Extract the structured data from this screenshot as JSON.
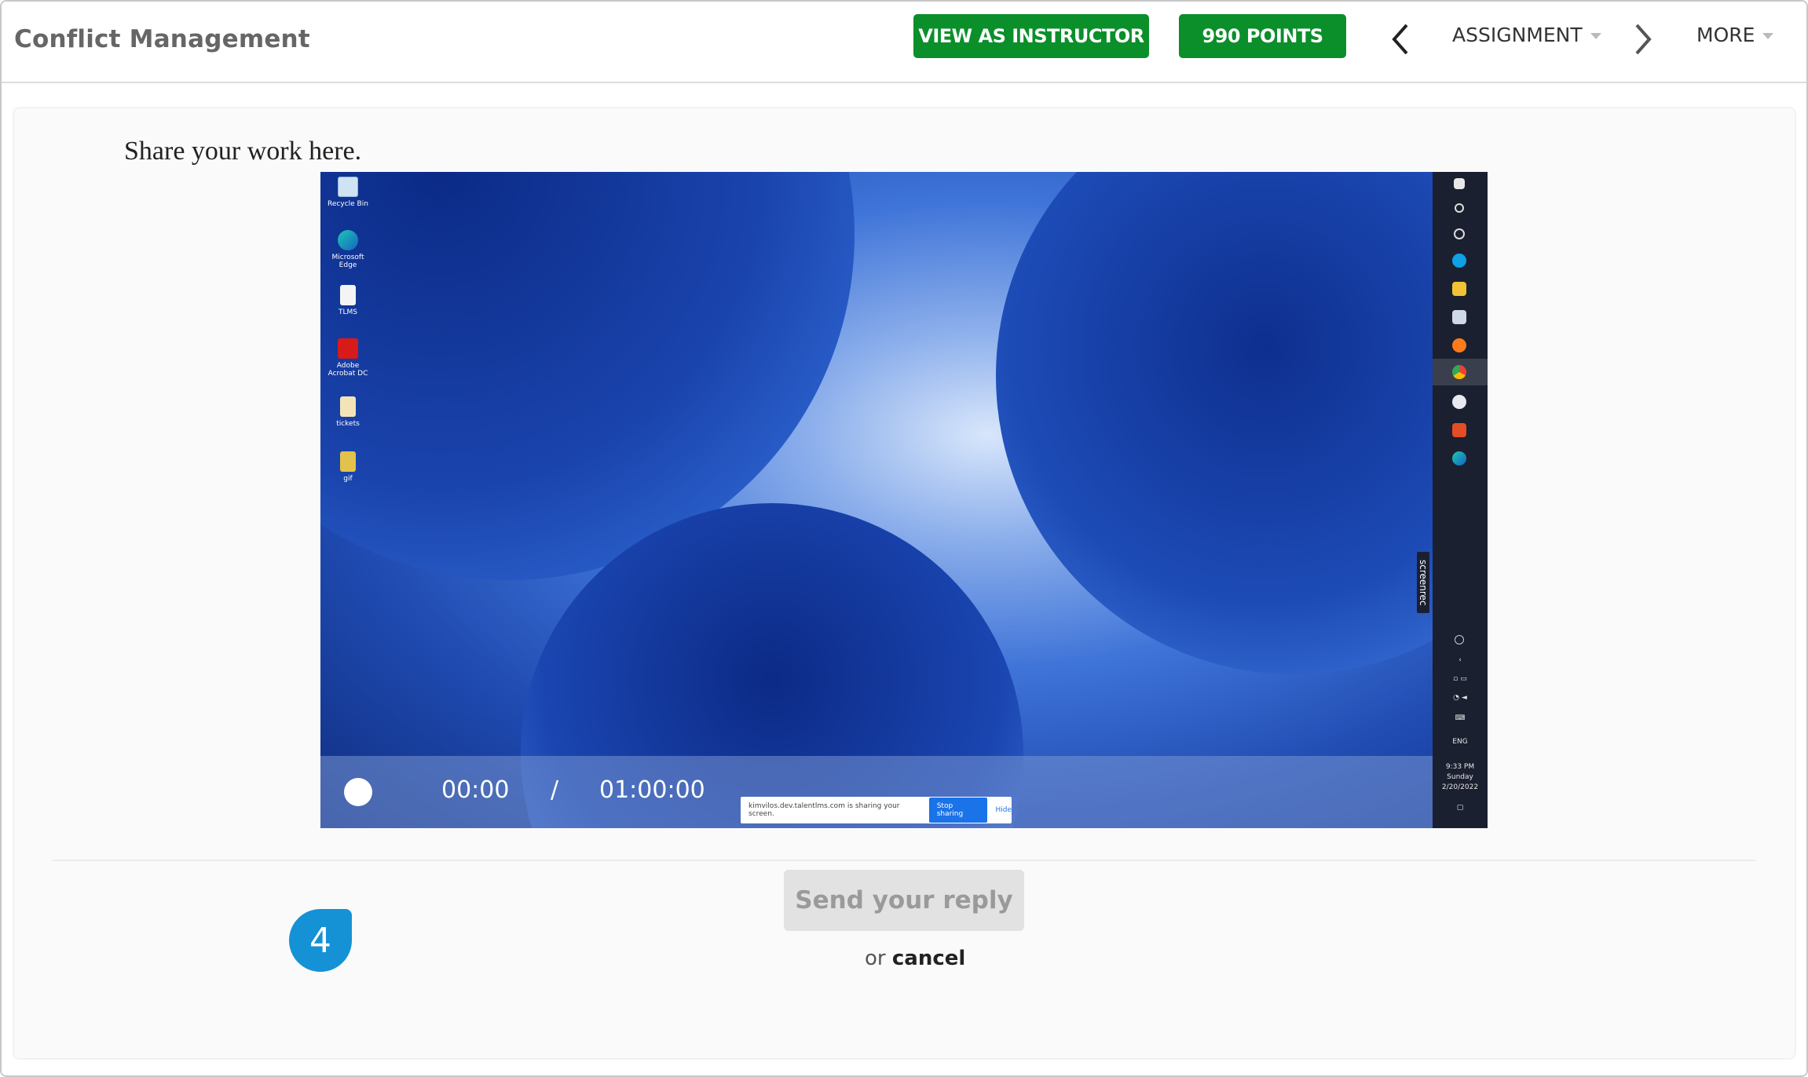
{
  "header": {
    "course_title": "Conflict Management",
    "instructor_button": "VIEW AS INSTRUCTOR",
    "points_button": "990 POINTS",
    "assignment_menu": "ASSIGNMENT",
    "more_menu": "MORE"
  },
  "main": {
    "prompt": "Share your work here.",
    "video": {
      "current_time": "00:00",
      "separator": "/",
      "duration": "01:00:00",
      "desktop_icons": [
        "Recycle Bin",
        "Microsoft Edge",
        "TLMS",
        "Adobe Acrobat DC",
        "tickets",
        "gif"
      ],
      "screenrec_label": "screenrec",
      "share_notice": "kimvilos.dev.talentlms.com is sharing your screen.",
      "stop_sharing": "Stop sharing",
      "hide": "Hide",
      "taskbar": {
        "language": "ENG",
        "clock_time": "9:33 PM",
        "clock_day": "Sunday",
        "clock_date": "2/20/2022"
      }
    },
    "step_badge": "4",
    "send_button": "Send your reply",
    "or_text": "or",
    "cancel_link": "cancel"
  },
  "colors": {
    "green_button": "#0a8f2a",
    "badge_blue": "#1592d6",
    "disabled_button": "#e2e2e2"
  }
}
